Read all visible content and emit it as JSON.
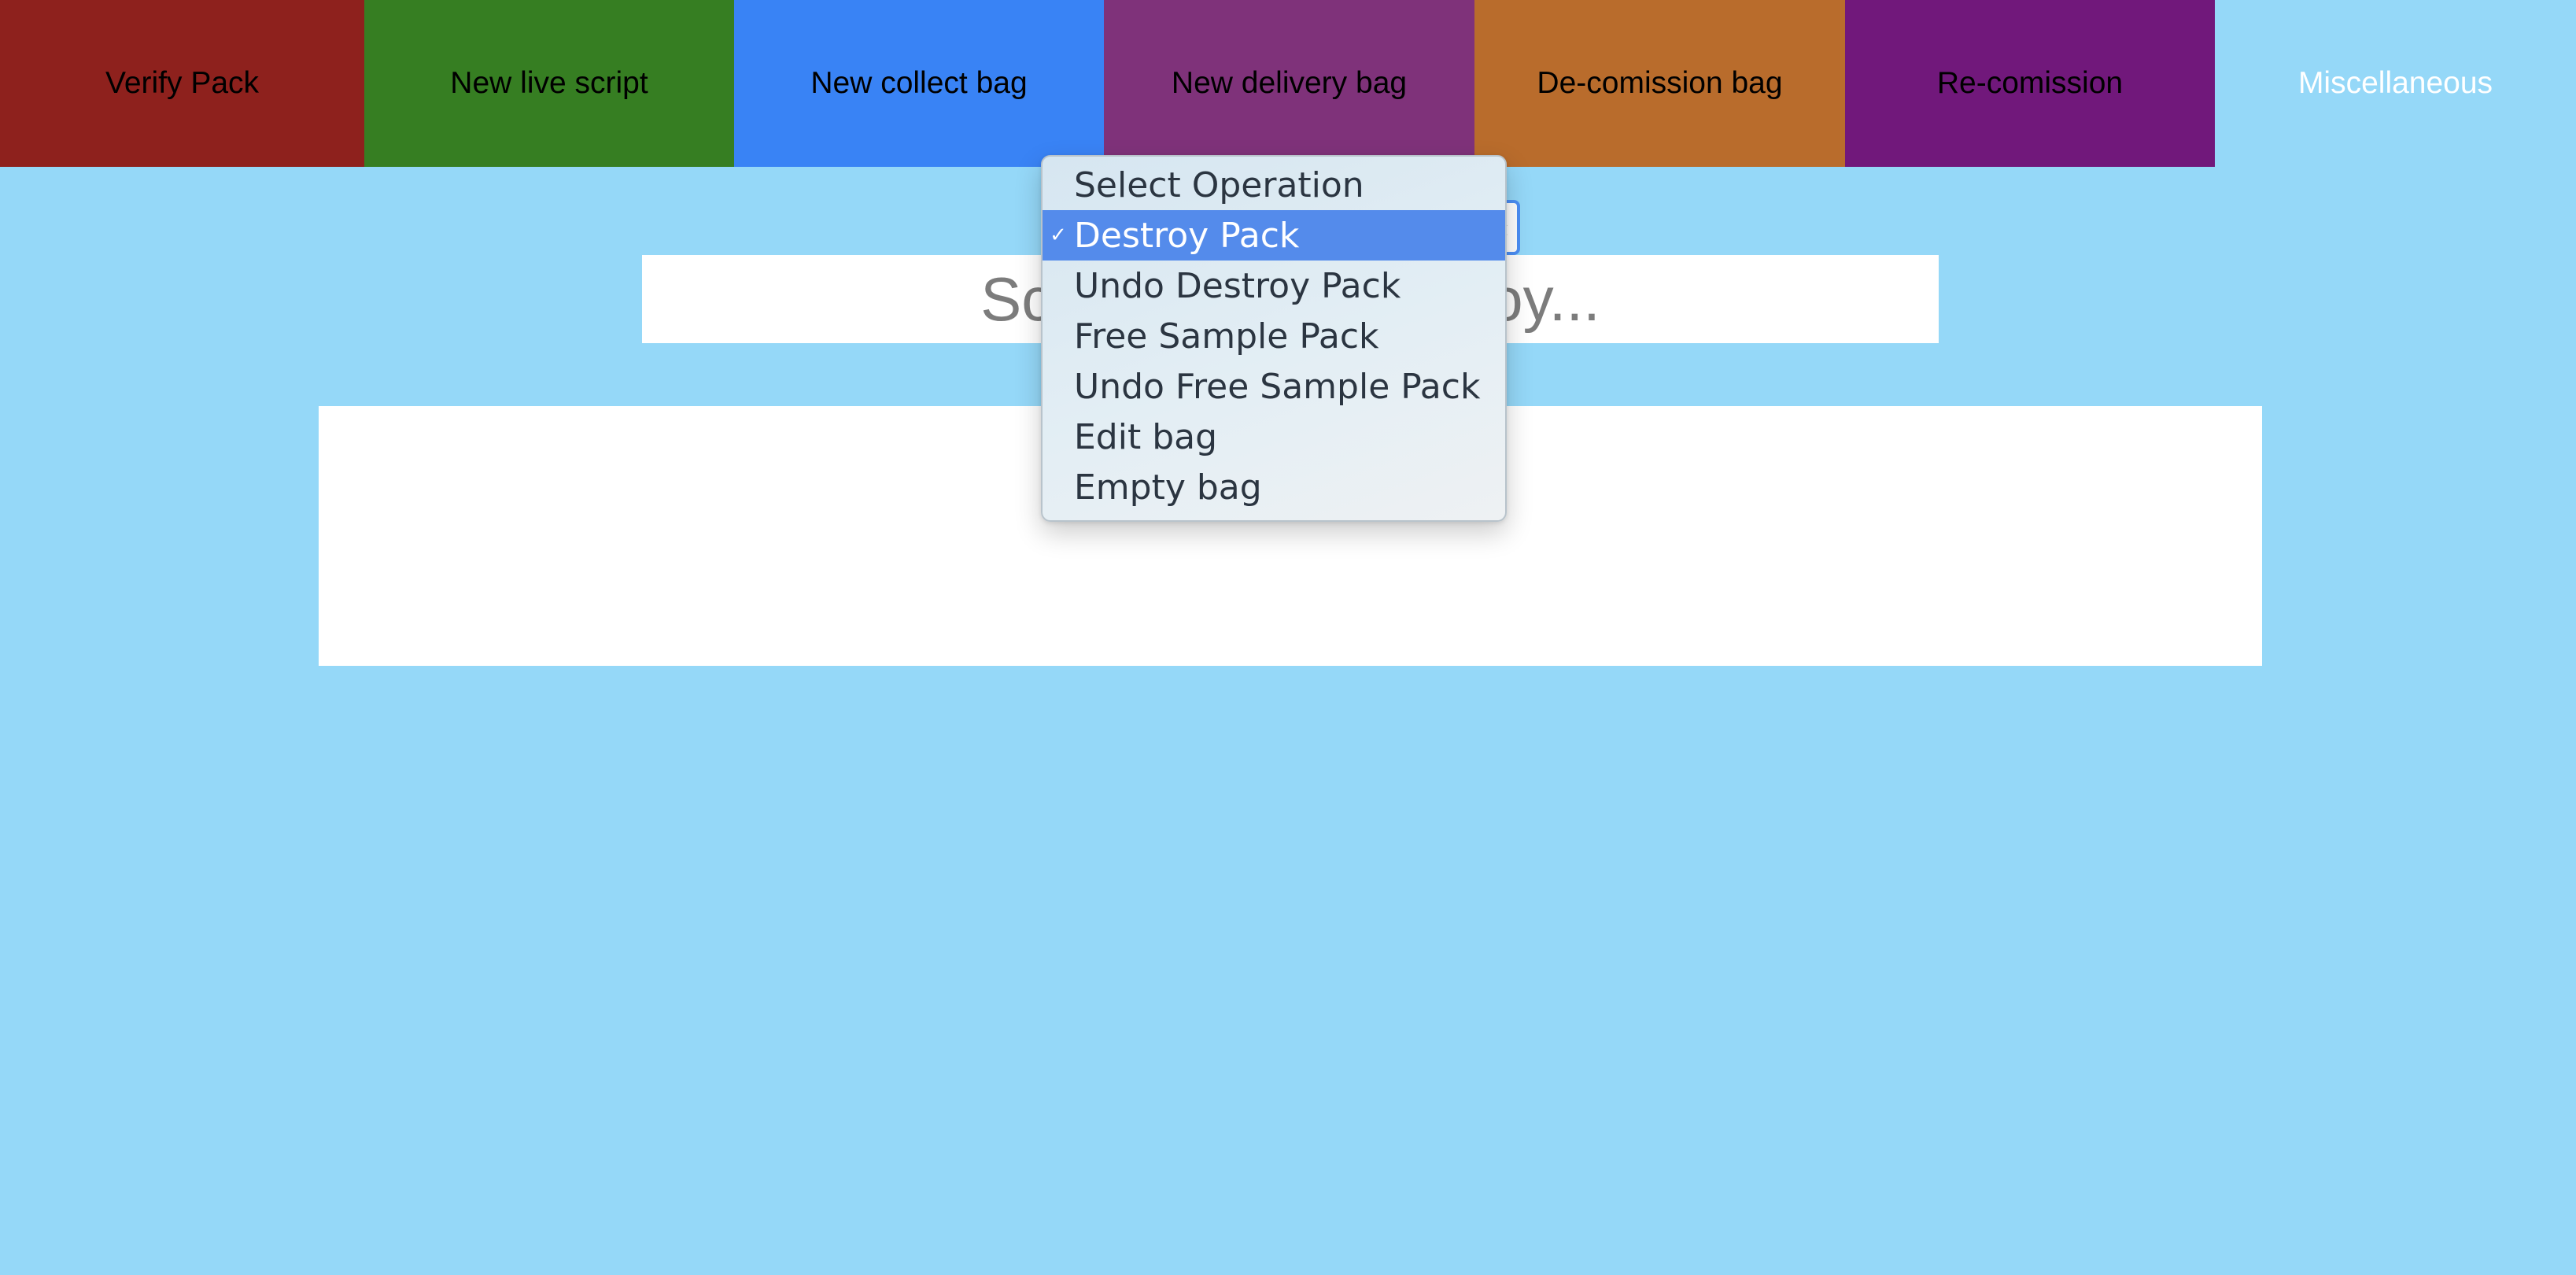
{
  "colors": {
    "page_background": "#95d8f8",
    "selected_highlight": "#548beb"
  },
  "nav": {
    "tabs": [
      {
        "label": "Verify Pack",
        "color": "#8e211d"
      },
      {
        "label": "New live script",
        "color": "#367e22"
      },
      {
        "label": "New collect bag",
        "color": "#3983f5"
      },
      {
        "label": "New delivery bag",
        "color": "#7f327a"
      },
      {
        "label": "De-comission bag",
        "color": "#b96c2c"
      },
      {
        "label": "Re-comission",
        "color": "#71187b"
      },
      {
        "label": "Miscellaneous",
        "color": "#95d8f8",
        "active": true
      }
    ]
  },
  "operation_select": {
    "selected_value": "Destroy Pack",
    "selected_mark": "✓",
    "options": [
      "Select Operation",
      "Destroy Pack",
      "Undo Destroy Pack",
      "Free Sample Pack",
      "Undo Free Sample Pack",
      "Edit bag",
      "Empty bag"
    ]
  },
  "scan": {
    "placeholder": "Scan pack to destroy...",
    "value": ""
  }
}
